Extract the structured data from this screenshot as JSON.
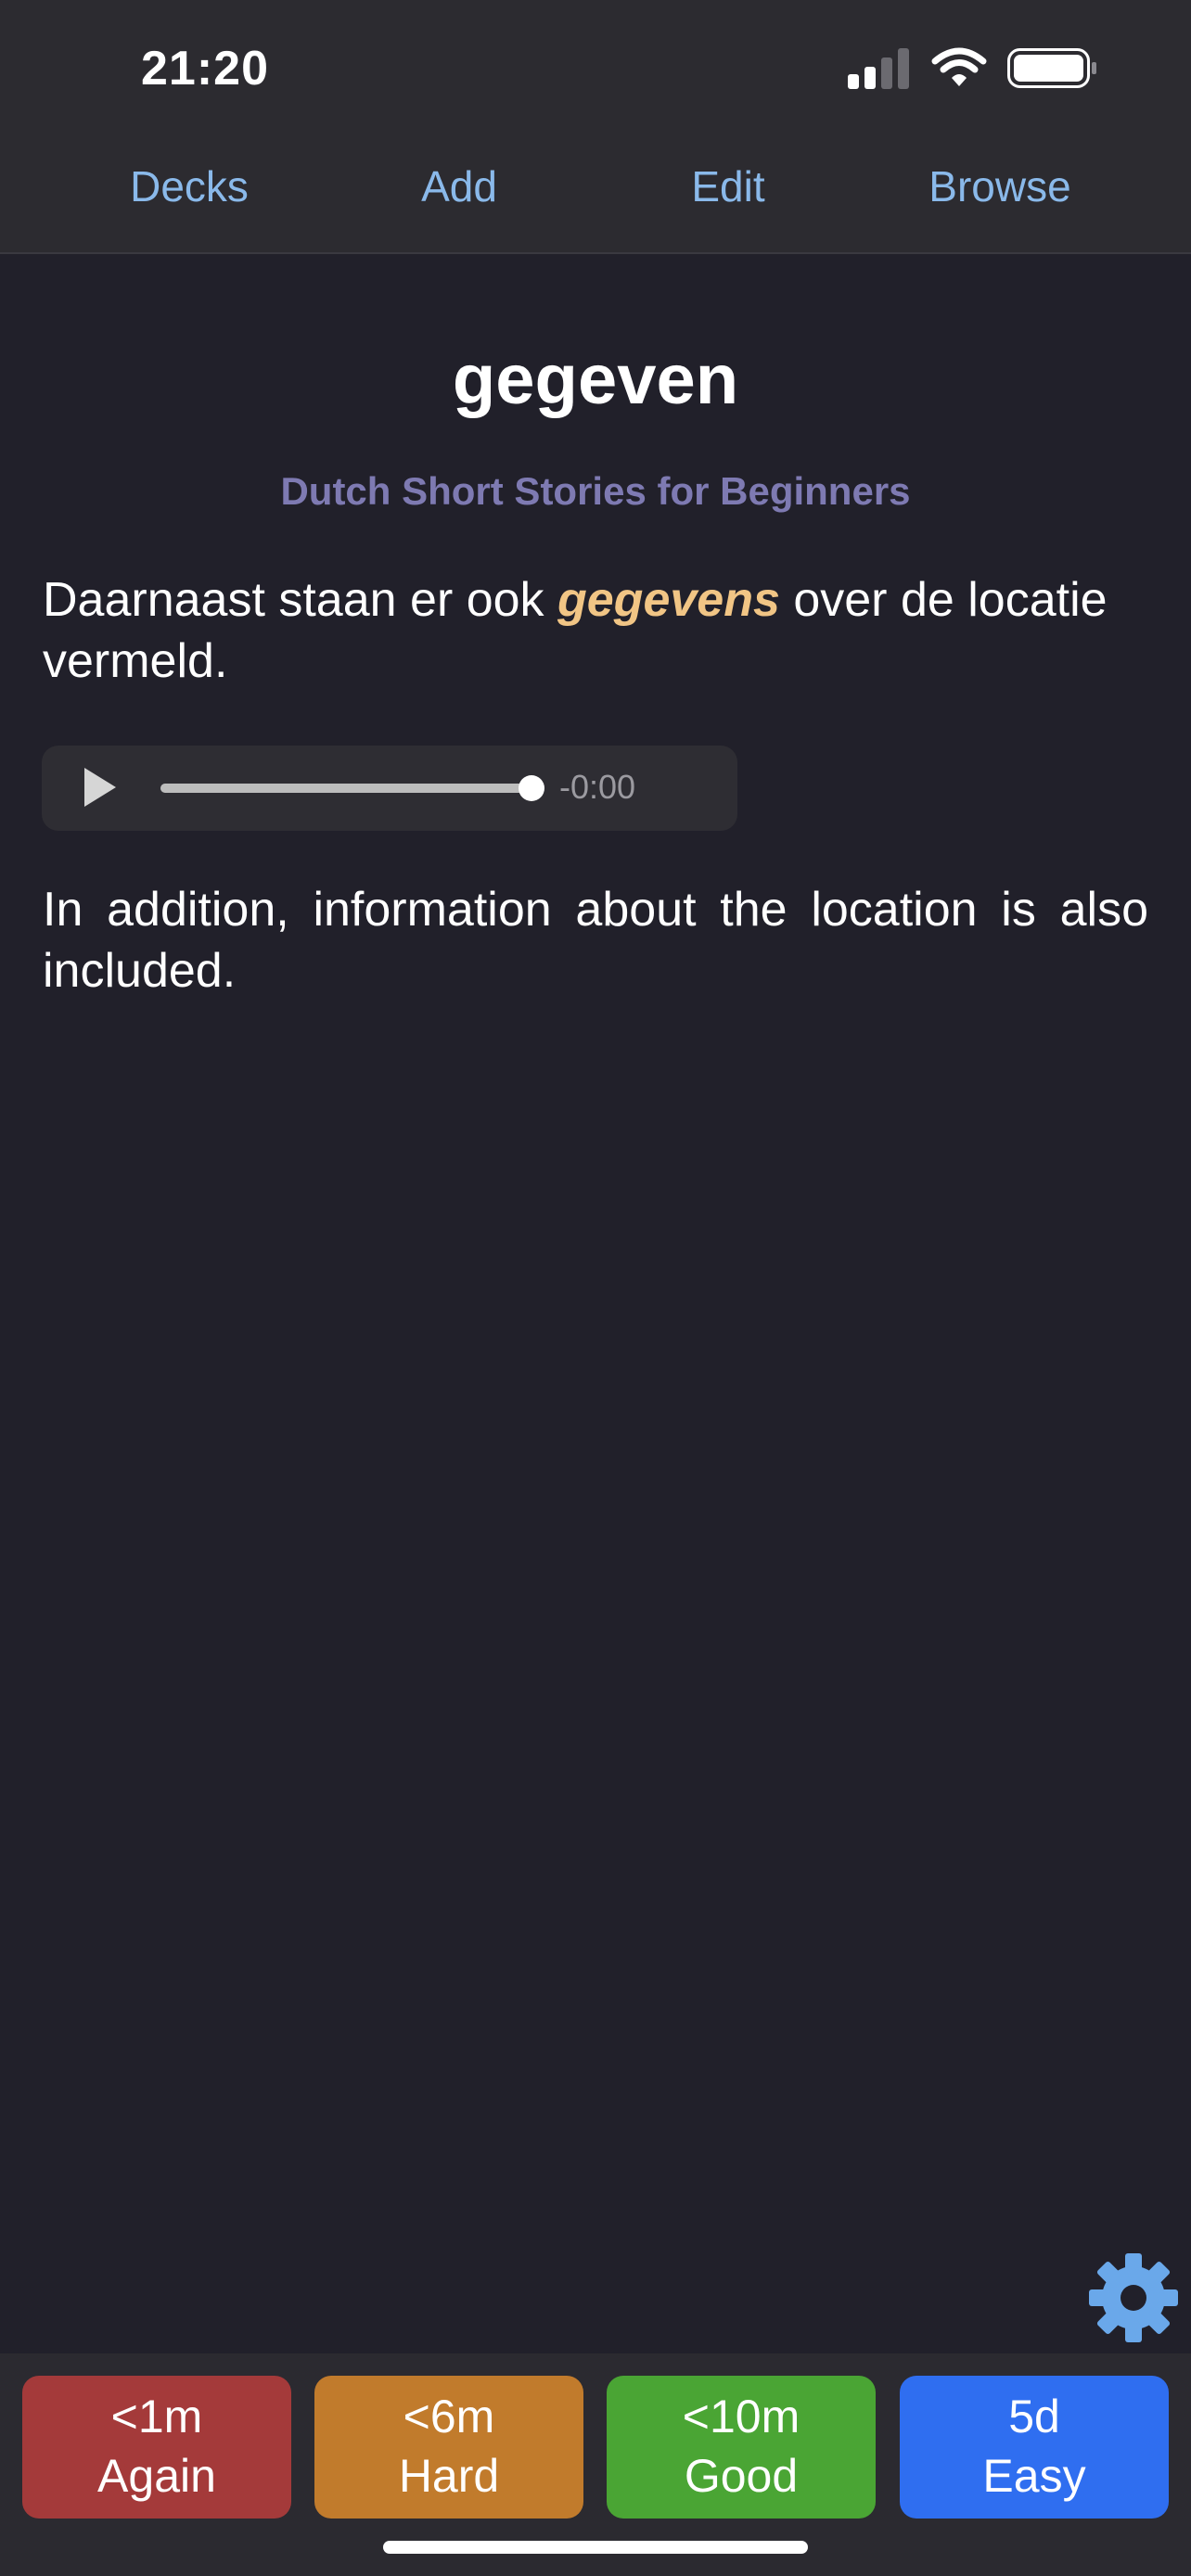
{
  "status_bar": {
    "time": "21:20"
  },
  "nav": {
    "decks": "Decks",
    "add": "Add",
    "edit": "Edit",
    "browse": "Browse",
    "color": "#8ab9ea"
  },
  "card": {
    "title": "gegeven",
    "deck_name": "Dutch Short Stories for Beginners",
    "sentence_before": "Daarnaast staan er ook ",
    "sentence_highlight": "gegevens",
    "sentence_after": " over de locatie vermeld.",
    "translation": "In addition, information about the location is also included.",
    "highlight_color": "#f1c585"
  },
  "audio_player": {
    "time_remaining": "-0:00",
    "progress": 1.0,
    "icon": "play-icon"
  },
  "settings": {
    "icon": "gear-icon",
    "color": "#6aa8ea"
  },
  "answer_buttons": [
    {
      "interval": "<1m",
      "label": "Again",
      "color": "#a43a3a"
    },
    {
      "interval": "<6m",
      "label": "Hard",
      "color": "#c17b2c"
    },
    {
      "interval": "<10m",
      "label": "Good",
      "color": "#4aa534"
    },
    {
      "interval": "5d",
      "label": "Easy",
      "color": "#2f6ef0"
    }
  ]
}
